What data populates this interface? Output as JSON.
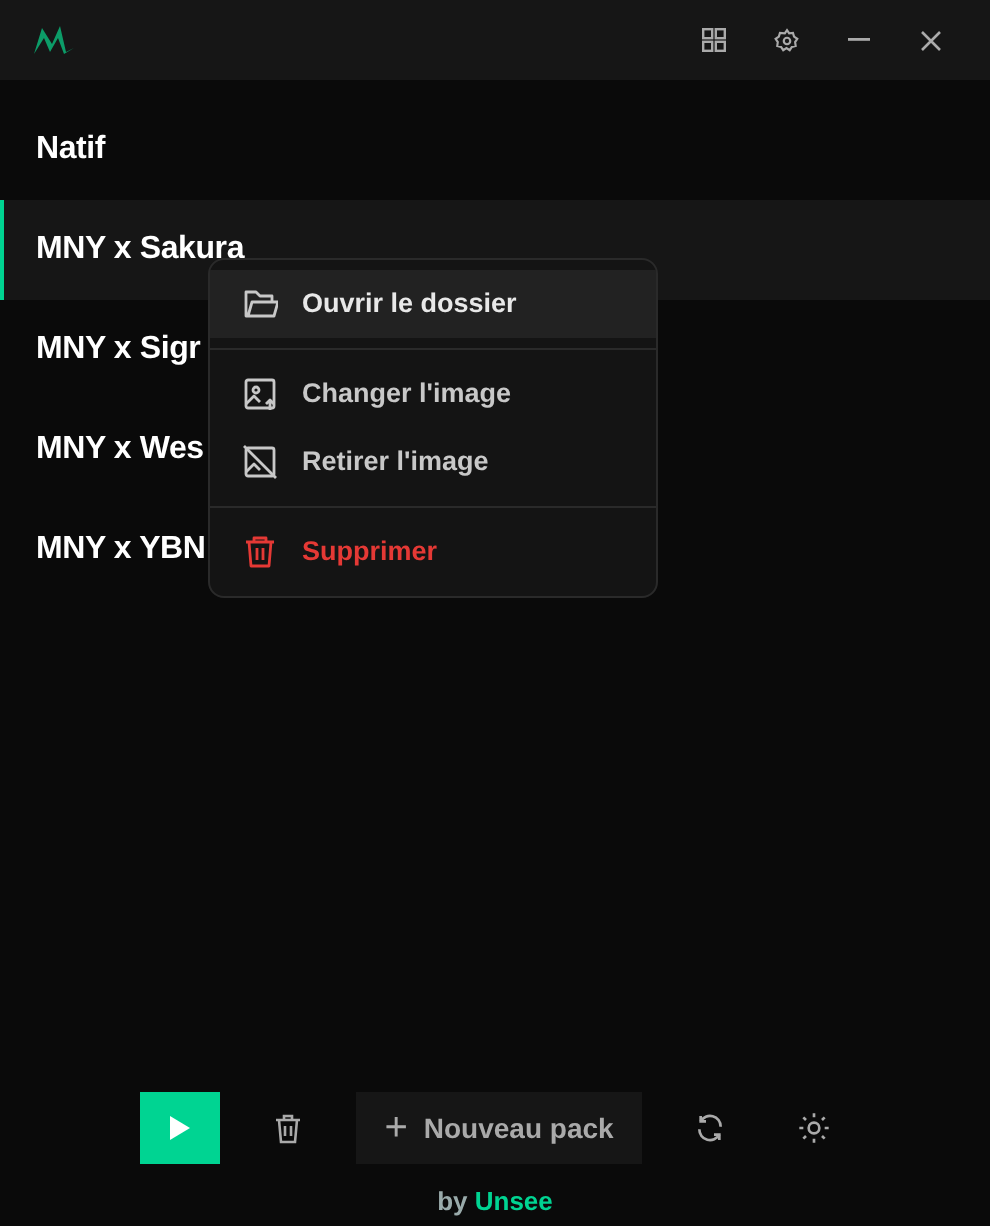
{
  "packs": [
    {
      "name": "Natif",
      "selected": false
    },
    {
      "name": "MNY x Sakura",
      "selected": true
    },
    {
      "name": "MNY x Sigr",
      "selected": false
    },
    {
      "name": "MNY x Wes",
      "selected": false
    },
    {
      "name": "MNY x YBN",
      "selected": false
    }
  ],
  "context_menu": {
    "groups": [
      [
        {
          "label": "Ouvrir le dossier",
          "kind": "open",
          "highlighted": true
        }
      ],
      [
        {
          "label": "Changer l'image",
          "kind": "change",
          "highlighted": false
        },
        {
          "label": "Retirer l'image",
          "kind": "remove",
          "highlighted": false
        }
      ],
      [
        {
          "label": "Supprimer",
          "kind": "danger",
          "highlighted": false
        }
      ]
    ]
  },
  "new_pack_button": {
    "label": "Nouveau pack",
    "icon": "+"
  },
  "footer": {
    "text": "by",
    "link": "Unsee"
  }
}
